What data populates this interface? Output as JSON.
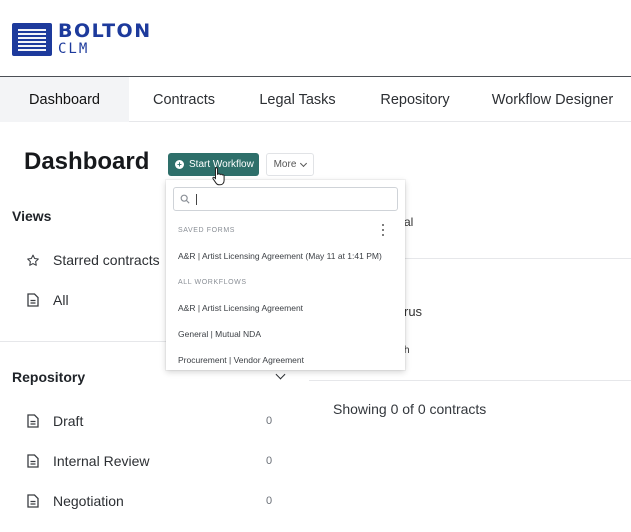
{
  "brand": {
    "name": "BOLTON",
    "sub": "CLM",
    "color": "#1d3a9c"
  },
  "nav": {
    "tabs": [
      {
        "label": "Dashboard",
        "active": true
      },
      {
        "label": "Contracts"
      },
      {
        "label": "Legal Tasks"
      },
      {
        "label": "Repository"
      },
      {
        "label": "Workflow Designer"
      }
    ]
  },
  "page": {
    "title": "Dashboard"
  },
  "toolbar": {
    "start_workflow_label": "Start Workflow",
    "more_label": "More",
    "accent": "#2e6f6a"
  },
  "views": {
    "title": "Views",
    "items": [
      {
        "label": "Starred contracts",
        "icon": "star-icon"
      },
      {
        "label": "All",
        "icon": "document-icon"
      }
    ]
  },
  "repository": {
    "title": "Repository",
    "items": [
      {
        "label": "Draft",
        "count": "0"
      },
      {
        "label": "Internal Review",
        "count": "0"
      },
      {
        "label": "Negotiation",
        "count": "0"
      }
    ]
  },
  "main": {
    "fragments": [
      "al",
      "rus",
      "h"
    ],
    "showing_text": "Showing 0 of 0 contracts"
  },
  "dropdown": {
    "search_value": "",
    "saved_forms_label": "SAVED FORMS",
    "saved_forms": [
      "A&R | Artist Licensing Agreement (May 11 at 1:41 PM)"
    ],
    "all_workflows_label": "ALL WORKFLOWS",
    "workflows": [
      "A&R | Artist Licensing Agreement",
      "General | Mutual NDA",
      "Procurement | Vendor Agreement"
    ]
  }
}
